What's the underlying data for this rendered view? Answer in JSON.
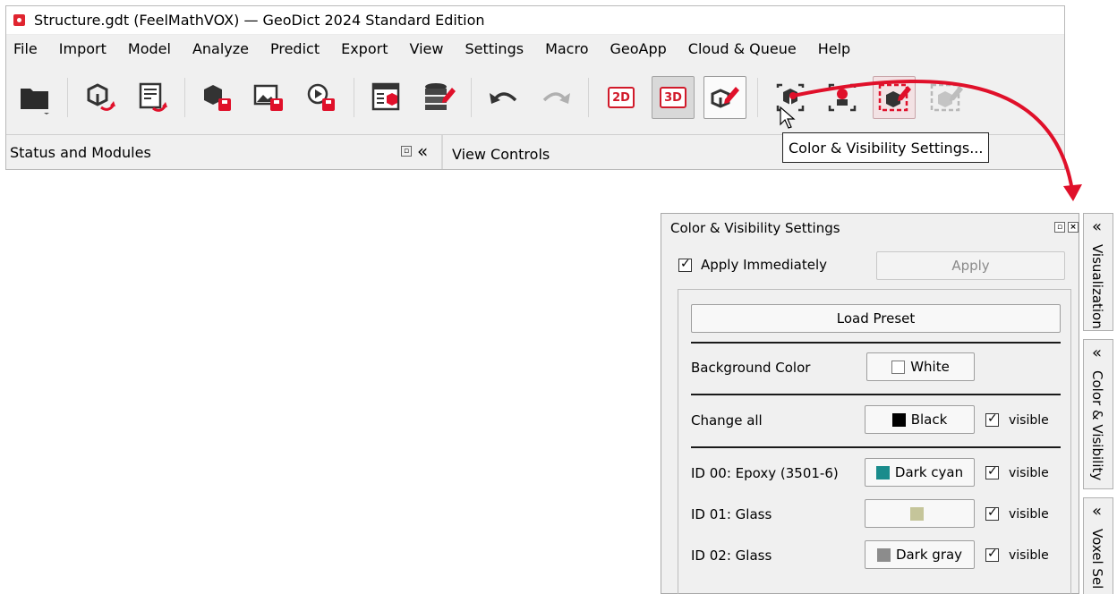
{
  "window": {
    "title": "Structure.gdt (FeelMathVOX) — GeoDict 2024 Standard Edition"
  },
  "menu": [
    {
      "label": "File"
    },
    {
      "label": "Import"
    },
    {
      "label": "Model"
    },
    {
      "label": "Analyze"
    },
    {
      "label": "Predict"
    },
    {
      "label": "Export"
    },
    {
      "label": "View"
    },
    {
      "label": "Settings"
    },
    {
      "label": "Macro"
    },
    {
      "label": "GeoApp"
    },
    {
      "label": "Cloud & Queue"
    },
    {
      "label": "Help"
    }
  ],
  "toolbar": {
    "mode_2d_label": "2D",
    "mode_3d_label": "3D",
    "icons": [
      "folder-open-icon",
      "export-structure-icon",
      "export-report-icon",
      "save-structure-icon",
      "save-image-icon",
      "save-animation-icon",
      "result-viewer-icon",
      "database-icon",
      "undo-icon",
      "redo-icon",
      "view-2d-icon",
      "view-3d-icon",
      "color-visibility-icon",
      "select-material-icon",
      "select-region-icon",
      "edit-selection-icon",
      "edit-selection-disabled-icon"
    ]
  },
  "statusbar": {
    "left_panel_title": "Status and Modules",
    "right_panel_title": "View Controls",
    "collapse_glyph": "«"
  },
  "tooltip": {
    "text": "Color & Visibility Settings..."
  },
  "accent_color": "#e0102a",
  "panel": {
    "title": "Color & Visibility Settings",
    "apply_immediately_label": "Apply Immediately",
    "apply_immediately_checked": true,
    "apply_button_label": "Apply",
    "load_preset_label": "Load Preset",
    "background": {
      "label": "Background Color",
      "color_name": "White",
      "swatch": "#ffffff"
    },
    "change_all": {
      "label": "Change all",
      "color_name": "Black",
      "swatch": "#000000",
      "visible_label": "visible"
    },
    "materials": [
      {
        "label": "ID 00: Epoxy (3501-6)",
        "color_name": "Dark cyan",
        "swatch": "#1a8c8c",
        "visible_label": "visible"
      },
      {
        "label": "ID 01: Glass",
        "color_name": "",
        "swatch": "#c5c59a",
        "visible_label": "visible"
      },
      {
        "label": "ID 02: Glass",
        "color_name": "Dark gray",
        "swatch": "#8c8c8c",
        "visible_label": "visible"
      }
    ]
  },
  "side_tabs": [
    {
      "label": "Visualization"
    },
    {
      "label": "Color & Visibility"
    },
    {
      "label": "Voxel Sel"
    }
  ]
}
